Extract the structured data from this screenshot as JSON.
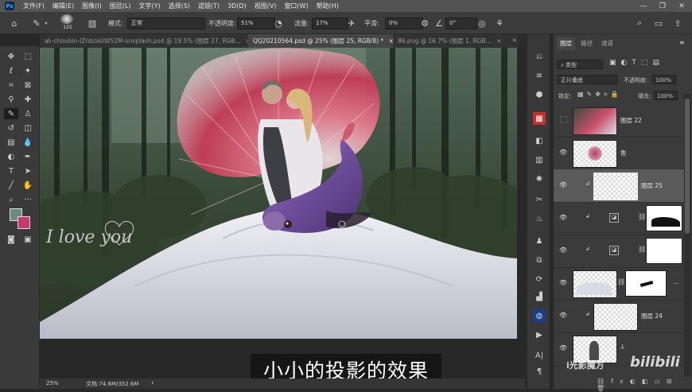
{
  "menubar": {
    "items": [
      "文件(F)",
      "编辑(E)",
      "图像(I)",
      "图层(L)",
      "文字(Y)",
      "选择(S)",
      "滤镜(T)",
      "3D(D)",
      "视图(V)",
      "窗口(W)",
      "帮助(H)"
    ],
    "minimize": "—",
    "restore": "❐",
    "close": "✕"
  },
  "options": {
    "brush_size": "125",
    "mode_label": "模式:",
    "mode_value": "正常",
    "opacity_label": "不透明度:",
    "opacity_value": "51%",
    "flow_label": "流量:",
    "flow_value": "17%",
    "smooth_label": "平滑:",
    "smooth_value": "0%",
    "angle_value": "0°"
  },
  "tabs": [
    {
      "label": "ali-choubin-IZnbzaUW52M-unsplash.psd @ 19.5% (图层 27, RGB...",
      "close": "×"
    },
    {
      "label": "QQ20210564.psd @ 25% (图层 25, RGB/8) *",
      "close": "×"
    },
    {
      "label": "86.png @ 16.7% (图层 1, RGB...",
      "close": "×"
    }
  ],
  "canvas": {
    "watermark_text": "I love you"
  },
  "subtitle": "小小的投影的效果",
  "status": {
    "zoom": "25%",
    "doc_info": "文档:74.6M/352.6M",
    "arrow": "›"
  },
  "layers_panel": {
    "tabs": [
      "图层",
      "路径",
      "通道"
    ],
    "filter_label": "类型",
    "blend_mode": "正片叠底",
    "opacity_label": "不透明度:",
    "opacity_value": "100%",
    "lock_label": "锁定:",
    "fill_label": "填充:",
    "fill_value": "100%",
    "layers": [
      {
        "name": "图层 22"
      },
      {
        "name": "鱼"
      },
      {
        "name": "图层 25"
      },
      {
        "name": ""
      },
      {
        "name": ""
      },
      {
        "name": ""
      },
      {
        "name": "图层 24"
      },
      {
        "name": ""
      }
    ]
  },
  "brand_watermark": {
    "text1": "i光影魔方",
    "text2": "bilibili"
  },
  "colors": {
    "foreground": "#6b8a82",
    "background": "#c23b6b",
    "accent": "#31a8ff"
  }
}
